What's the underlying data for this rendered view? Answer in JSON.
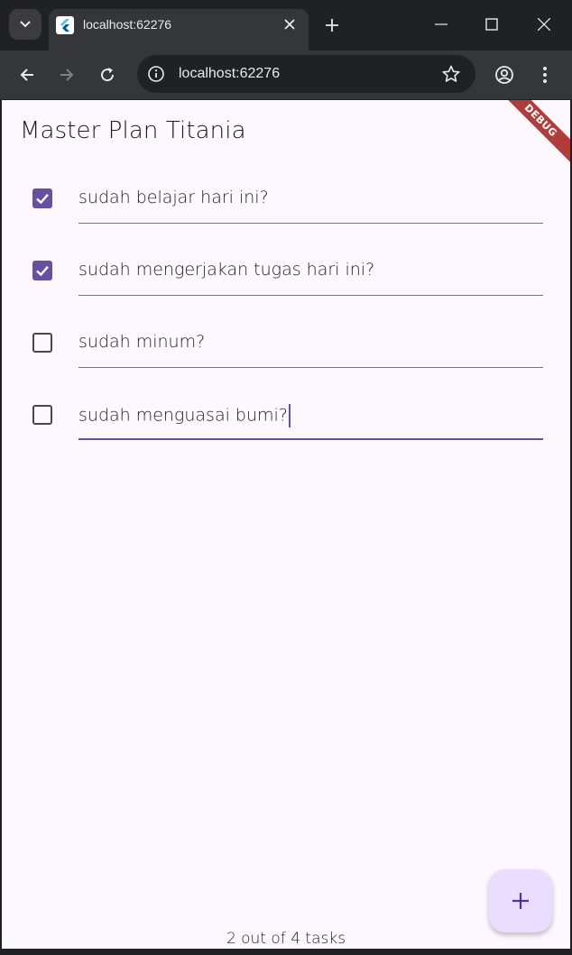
{
  "browser": {
    "tab_title": "localhost:62276",
    "url": "localhost:62276"
  },
  "app": {
    "title": "Master Plan Titania",
    "debug_banner": "DEBUG",
    "tasks": [
      {
        "text": "sudah belajar hari ini?",
        "done": true
      },
      {
        "text": "sudah mengerjakan tugas hari ini?",
        "done": true
      },
      {
        "text": "sudah minum?",
        "done": false
      },
      {
        "text": "sudah menguasai bumi?",
        "done": false
      }
    ],
    "footer": "2 out of 4 tasks",
    "colors": {
      "primary": "#6750a4",
      "background": "#fdf7ff",
      "fab": "#eaddff"
    }
  }
}
